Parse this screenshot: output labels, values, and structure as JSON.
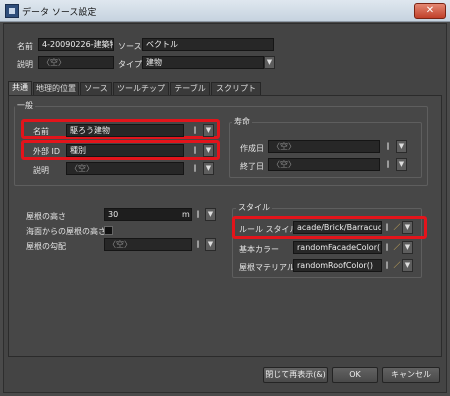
{
  "window": {
    "title": "データ ソース設定",
    "close_glyph": "✕"
  },
  "header": {
    "name_label": "名前",
    "name_value": "4-20090226-建築物",
    "source_label": "ソース",
    "source_value": "ベクトル",
    "desc_label": "説明",
    "desc_placeholder": "〈空〉",
    "type_label": "タイプ",
    "type_value": "建物"
  },
  "tabs": [
    "共通",
    "地理的位置",
    "ソース",
    "ツールチップ",
    "テーブル",
    "スクリプト"
  ],
  "general": {
    "group_title": "一般",
    "name_label": "名前",
    "name_value": "駆ろう建物",
    "external_id_label": "外部 ID",
    "external_id_value": "種別",
    "desc_label": "説明",
    "desc_placeholder": "〈空〉"
  },
  "lifetime": {
    "group_title": "寿命",
    "created_label": "作成日",
    "created_placeholder": "〈空〉",
    "end_label": "終了日",
    "end_placeholder": "〈空〉"
  },
  "roof": {
    "height_label": "屋根の高さ",
    "height_value": "30",
    "height_unit": "m",
    "sea_level_label": "海面からの屋根の高さ",
    "slope_label": "屋根の勾配",
    "slope_placeholder": "〈空〉"
  },
  "style": {
    "group_title": "スタイル",
    "rule_label": "ルール スタイル",
    "rule_value": "acade/Brick/Barracuda'",
    "base_color_label": "基本カラー",
    "base_color_value": "randomFacadeColor()",
    "roof_material_label": "屋根マテリアル",
    "roof_material_value": "randomRoofColor()"
  },
  "buttons": {
    "close_show": "閉じて再表示(&)",
    "ok": "OK",
    "cancel": "キャンセル"
  },
  "glyphs": {
    "dropdown": "▼",
    "spin": "‖",
    "edit": "／"
  }
}
